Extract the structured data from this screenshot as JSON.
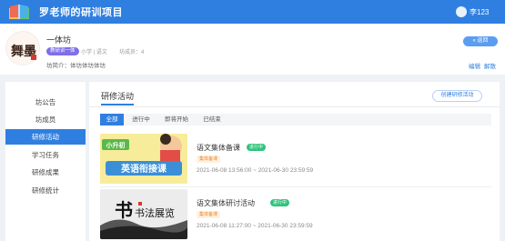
{
  "header": {
    "app_title": "罗老师的研训项目",
    "user_name": "李123"
  },
  "group": {
    "name": "一体坊",
    "tag": "教研训一体",
    "meta": "小学 | 语文",
    "members": "坊成员：4",
    "intro": "坊简介：体坊体坊体坊",
    "back_label": "返回",
    "edit_label": "编辑",
    "dissolve_label": "解散",
    "avatar_text": "舞墨"
  },
  "sidebar": {
    "items": [
      {
        "label": "坊公告",
        "active": false
      },
      {
        "label": "坊成员",
        "active": false
      },
      {
        "label": "研修活动",
        "active": true
      },
      {
        "label": "学习任务",
        "active": false
      },
      {
        "label": "研修成果",
        "active": false
      },
      {
        "label": "研修统计",
        "active": false
      }
    ]
  },
  "main": {
    "title": "研修活动",
    "create_label": "创建研修活动",
    "tabs": [
      {
        "label": "全部",
        "active": true
      },
      {
        "label": "进行中",
        "active": false
      },
      {
        "label": "即将开始",
        "active": false
      },
      {
        "label": "已结束",
        "active": false
      }
    ],
    "activities": [
      {
        "title": "语文集体备课",
        "status": "进行中",
        "type": "集体备课",
        "time": "2021-06-08 13:56:00 ~ 2021-06-30 23:59:59",
        "thumb_text": "英语衔接课",
        "thumb_badge": "小升初"
      },
      {
        "title": "语文集体研讨活动",
        "status": "进行中",
        "type": "集体备课",
        "time": "2021-06-08 11:27:00 ~ 2021-06-30 23:59:59",
        "thumb_text": "书法展览"
      }
    ]
  },
  "colors": {
    "brand": "#2f7fe1",
    "status_green": "#2ec47a",
    "tag_purple": "#7e6ee8",
    "tag_orange": "#f08a2a"
  }
}
